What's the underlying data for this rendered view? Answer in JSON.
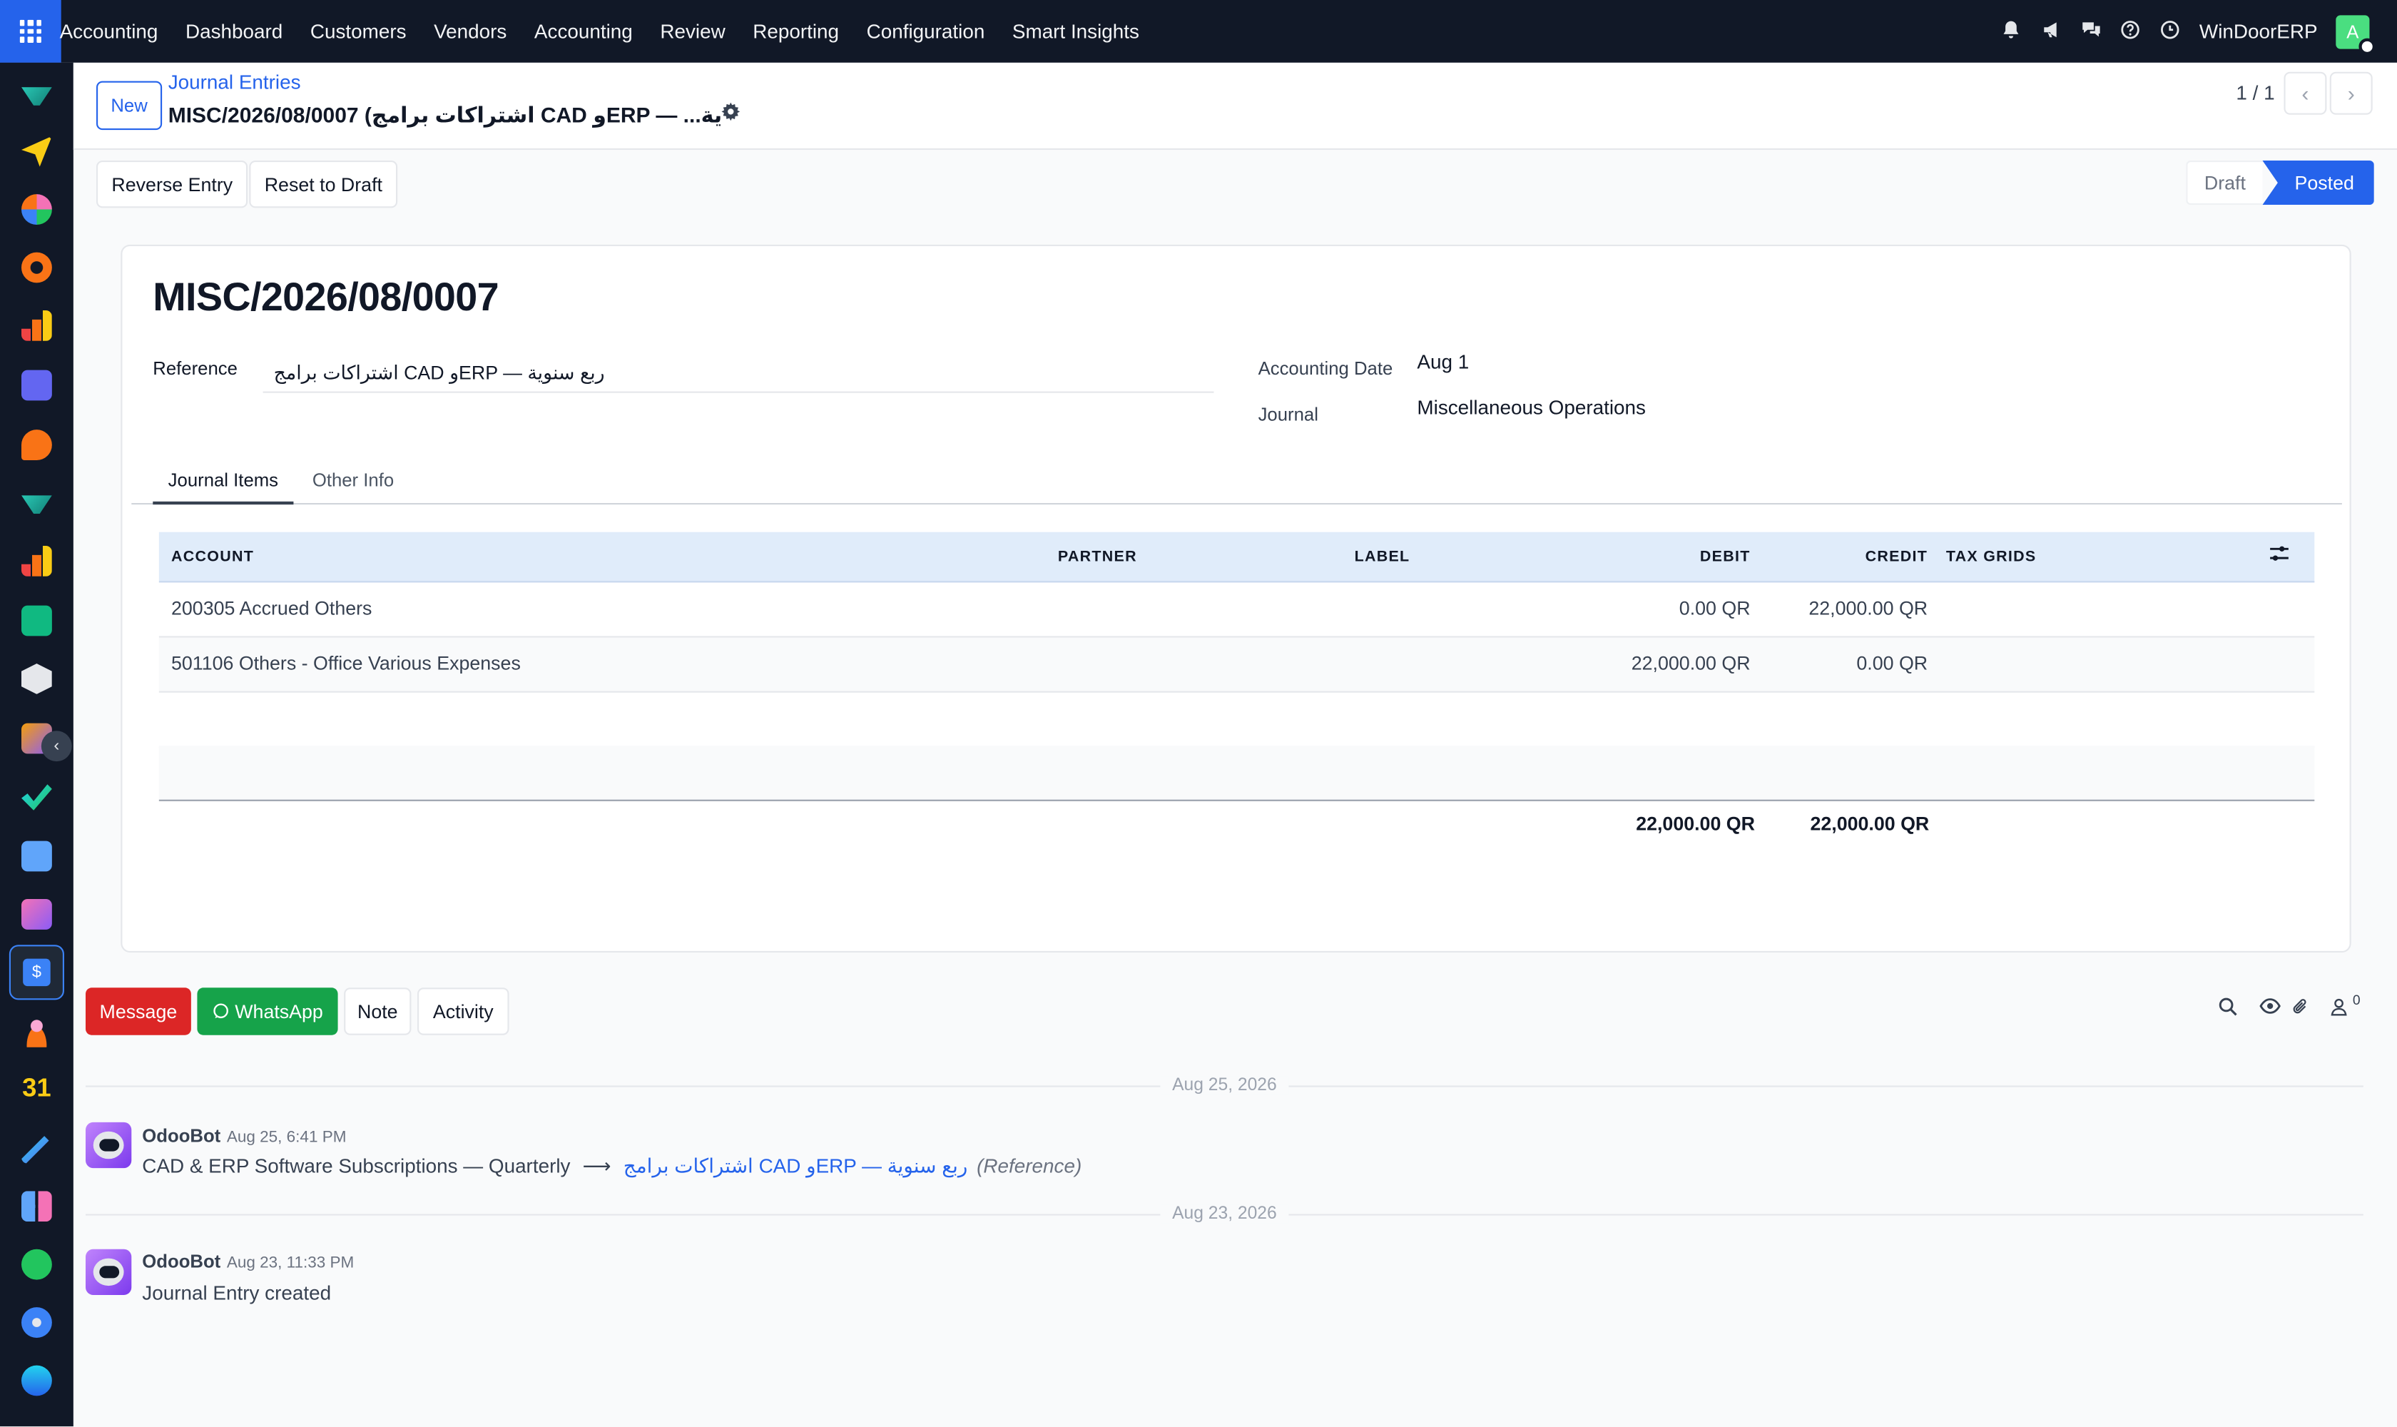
{
  "top_nav": {
    "brand": "Accounting",
    "menu": [
      "Dashboard",
      "Customers",
      "Vendors",
      "Accounting",
      "Review",
      "Reporting",
      "Configuration",
      "Smart Insights"
    ],
    "company": "WinDoorERP",
    "user_initial": "A"
  },
  "control_panel": {
    "new_label": "New",
    "breadcrumb": "Journal Entries",
    "record_title": "MISC/2026/08/0007 (اشتراكات برامج CAD وERP — ...ية",
    "pager": "1 / 1"
  },
  "status_bar": {
    "reverse_label": "Reverse Entry",
    "reset_label": "Reset to Draft",
    "stages": [
      "Draft",
      "Posted"
    ],
    "current_stage": "Posted"
  },
  "form": {
    "title": "MISC/2026/08/0007",
    "reference_label": "Reference",
    "reference_value": "اشتراكات برامج CAD وERP — ربع سنوية",
    "accounting_date_label": "Accounting Date",
    "accounting_date_value": "Aug 1",
    "journal_label": "Journal",
    "journal_value": "Miscellaneous Operations",
    "tabs": [
      "Journal Items",
      "Other Info"
    ]
  },
  "table": {
    "columns": [
      "ACCOUNT",
      "PARTNER",
      "LABEL",
      "DEBIT",
      "CREDIT",
      "TAX GRIDS"
    ],
    "rows": [
      {
        "account": "200305 Accrued Others",
        "partner": "",
        "label": "",
        "debit": "0.00 QR",
        "credit": "22,000.00 QR",
        "tax_grids": ""
      },
      {
        "account": "501106 Others - Office Various Expenses",
        "partner": "",
        "label": "",
        "debit": "22,000.00 QR",
        "credit": "0.00 QR",
        "tax_grids": ""
      }
    ],
    "total_debit": "22,000.00 QR",
    "total_credit": "22,000.00 QR"
  },
  "chatter": {
    "message_label": "Message",
    "whatsapp_label": "WhatsApp",
    "note_label": "Note",
    "activity_label": "Activity",
    "follower_count": "0",
    "messages": [
      {
        "date_separator": "Aug 25, 2026",
        "author": "OdooBot",
        "datetime": "Aug 25, 6:41 PM",
        "old_value": "CAD & ERP Software Subscriptions — Quarterly",
        "new_value": "اشتراكات برامج CAD وERP — ربع سنوية",
        "field": "(Reference)"
      },
      {
        "date_separator": "Aug 23, 2026",
        "author": "OdooBot",
        "datetime": "Aug 23, 11:33 PM",
        "body": "Journal Entry created"
      }
    ]
  },
  "colors": {
    "nav_bg": "#111827",
    "primary": "#2563eb",
    "message_btn": "#dc2626",
    "whatsapp_btn": "#16a34a",
    "table_header": "#e0ecfa"
  },
  "icons": [
    "apps-grid-icon",
    "bell-icon",
    "megaphone-icon",
    "chat-icon",
    "help-icon",
    "clock-icon",
    "gear-icon",
    "chevron-left-icon",
    "chevron-right-icon",
    "column-settings-icon",
    "search-icon",
    "eye-icon",
    "paperclip-icon",
    "followers-icon",
    "whatsapp-icon"
  ]
}
